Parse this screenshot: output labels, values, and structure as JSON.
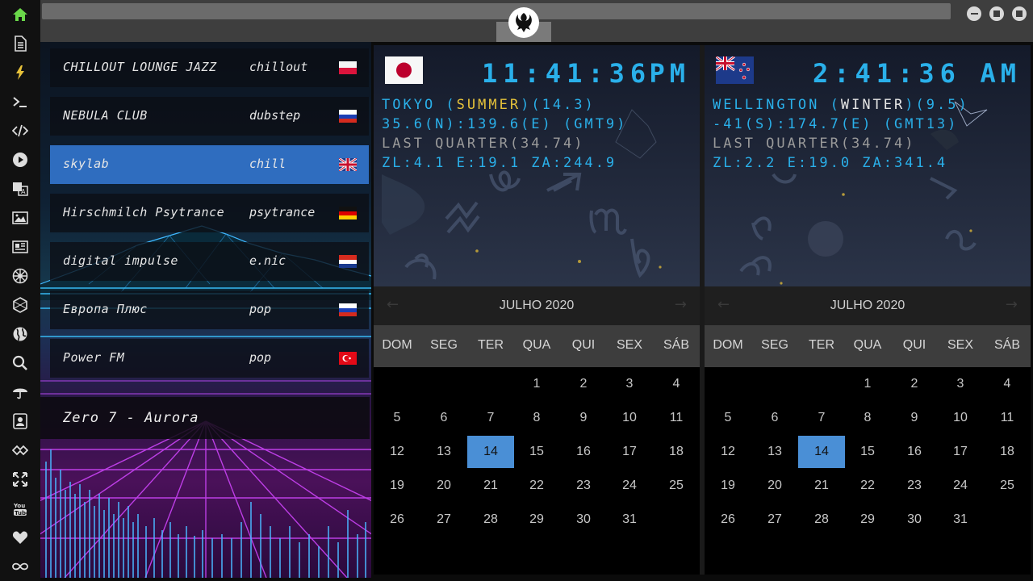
{
  "sidebar": {
    "icons": [
      "home-icon",
      "file-icon",
      "bolt-icon",
      "terminal-icon",
      "code-icon",
      "play-icon",
      "translate-icon",
      "image-icon",
      "newspaper-icon",
      "empire-icon",
      "hexagon-icon",
      "globe-icon",
      "search-icon",
      "umbrella-icon",
      "contact-card-icon",
      "shake-icon",
      "expand-icon",
      "youtube-icon",
      "heart-icon",
      "infinity-icon"
    ],
    "accent": "#6ad84a"
  },
  "topbar": {
    "logo": "rebel-alliance-icon"
  },
  "radio": {
    "stations": [
      {
        "name": "CHILLOUT LOUNGE JAZZ",
        "genre": "chillout",
        "flag": "poland"
      },
      {
        "name": "NEBULA CLUB",
        "genre": "dubstep",
        "flag": "russia"
      },
      {
        "name": "skylab",
        "genre": "chill",
        "flag": "uk"
      },
      {
        "name": "Hirschmilch Psytrance",
        "genre": "psytrance",
        "flag": "germany"
      },
      {
        "name": "digital impulse",
        "genre": "e.nic",
        "flag": "croatia"
      },
      {
        "name": "Европа Плюс",
        "genre": "pop",
        "flag": "russia"
      },
      {
        "name": "Power FM",
        "genre": "pop",
        "flag": "turkey"
      }
    ],
    "now_playing": "Zero 7 - Aurora"
  },
  "clocks": [
    {
      "flag": "japan",
      "time": "11:41:36",
      "ampm": "PM",
      "city": "TOKYO",
      "season": "SUMMER",
      "temp": "14.3",
      "coords": "35.6(N):139.6(E) (GMT9)",
      "moon": "LAST QUARTER(34.74)",
      "zone": "ZL:4.1 E:19.1 ZA:244.9"
    },
    {
      "flag": "new-zealand",
      "time": "2:41:36",
      "ampm": "AM",
      "city": "WELLINGTON",
      "season": "WINTER",
      "temp": "9.5",
      "coords": "-41(S):174.7(E) (GMT13)",
      "moon": "LAST QUARTER(34.74)",
      "zone": "ZL:2.2 E:19.0 ZA:341.4"
    }
  ],
  "calendar": {
    "month": "JULHO 2020",
    "weekdays": [
      "DOM",
      "SEG",
      "TER",
      "QUA",
      "QUI",
      "SEX",
      "SÁB"
    ],
    "weeks": [
      [
        "",
        "",
        "",
        "1",
        "2",
        "3",
        "4"
      ],
      [
        "5",
        "6",
        "7",
        "8",
        "9",
        "10",
        "11"
      ],
      [
        "12",
        "13",
        "14",
        "15",
        "16",
        "17",
        "18"
      ],
      [
        "19",
        "20",
        "21",
        "22",
        "23",
        "24",
        "25"
      ],
      [
        "26",
        "27",
        "28",
        "29",
        "30",
        "31",
        ""
      ]
    ],
    "today": "14",
    "today_color": "#4a8fd6"
  }
}
